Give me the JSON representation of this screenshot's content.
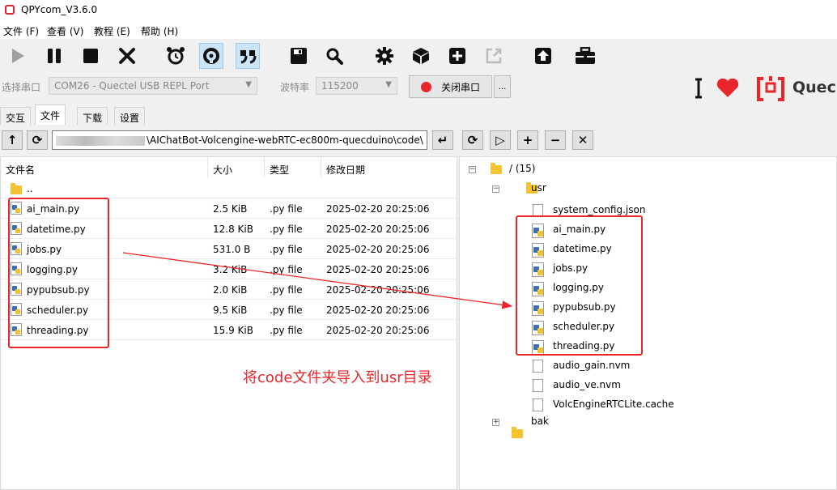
{
  "window": {
    "title": "QPYcom_V3.6.0"
  },
  "menu": [
    "文件 (F)",
    "查看 (V)",
    "教程 (E)",
    "帮助 (H)"
  ],
  "toolbar": {
    "icons": [
      "play-icon",
      "pause-icon",
      "stop-icon",
      "close-icon",
      "alarm-icon",
      "recycle-icon",
      "quote-icon",
      "save-icon",
      "search-icon",
      "gear-icon",
      "cube-icon",
      "plus-icon",
      "export-icon",
      "upload-icon",
      "toolbox-icon"
    ]
  },
  "port": {
    "port_label": "选择串口",
    "port_value": "COM26 - Quectel USB REPL Port",
    "baud_label": "波特率",
    "baud_value": "115200",
    "close_port_label": "关闭串口",
    "more_label": "...",
    "brand_text": "Quecl",
    "accent": "#e8262b"
  },
  "tabs": [
    "交互",
    "文件",
    "下载",
    "设置"
  ],
  "left_pane": {
    "path_visible": "\\AIChatBot-Volcengine-webRTC-ec800m-quecduino\\code\\",
    "columns": [
      "文件名",
      "大小",
      "类型",
      "修改日期"
    ],
    "parent_entry": "..",
    "files": [
      {
        "name": "ai_main.py",
        "size": "2.5 KiB",
        "type": ".py file",
        "date": "2025-02-20 20:25:06"
      },
      {
        "name": "datetime.py",
        "size": "12.8 KiB",
        "type": ".py file",
        "date": "2025-02-20 20:25:06"
      },
      {
        "name": "jobs.py",
        "size": "531.0 B",
        "type": ".py file",
        "date": "2025-02-20 20:25:06"
      },
      {
        "name": "logging.py",
        "size": "3.2 KiB",
        "type": ".py file",
        "date": "2025-02-20 20:25:06"
      },
      {
        "name": "pypubsub.py",
        "size": "2.0 KiB",
        "type": ".py file",
        "date": "2025-02-20 20:25:06"
      },
      {
        "name": "scheduler.py",
        "size": "9.5 KiB",
        "type": ".py file",
        "date": "2025-02-20 20:25:06"
      },
      {
        "name": "threading.py",
        "size": "15.9 KiB",
        "type": ".py file",
        "date": "2025-02-20 20:25:06"
      }
    ]
  },
  "right_pane": {
    "root_label": "/ (15)",
    "usr_label": "usr",
    "usr_children": [
      {
        "name": "system_config.json",
        "kind": "file"
      },
      {
        "name": "ai_main.py",
        "kind": "py"
      },
      {
        "name": "datetime.py",
        "kind": "py"
      },
      {
        "name": "jobs.py",
        "kind": "py"
      },
      {
        "name": "logging.py",
        "kind": "py"
      },
      {
        "name": "pypubsub.py",
        "kind": "py"
      },
      {
        "name": "scheduler.py",
        "kind": "py"
      },
      {
        "name": "threading.py",
        "kind": "py"
      },
      {
        "name": "audio_gain.nvm",
        "kind": "file"
      },
      {
        "name": "audio_ve.nvm",
        "kind": "file"
      },
      {
        "name": "VolcEngineRTCLite.cache",
        "kind": "file"
      }
    ],
    "bak_label": "bak"
  },
  "annotation": "将code文件夹导入到usr目录"
}
